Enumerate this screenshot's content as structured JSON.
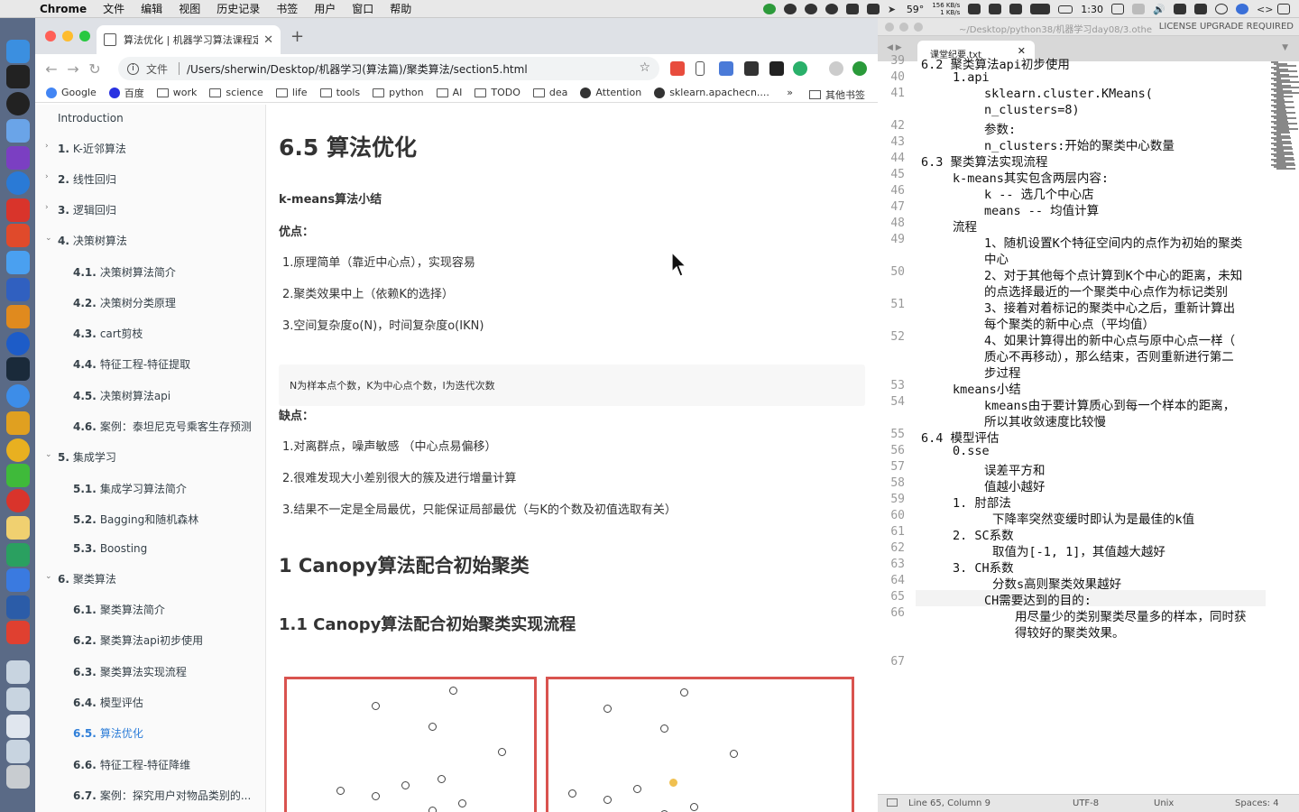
{
  "menubar": {
    "app": "Chrome",
    "menus": [
      "文件",
      "编辑",
      "视图",
      "历史记录",
      "书签",
      "用户",
      "窗口",
      "帮助"
    ],
    "temp": "59°",
    "net_up": "156 KB/s",
    "net_down": "1 KB/s",
    "battery": "1:30"
  },
  "browser": {
    "tab_title": "算法优化 | 机器学习算法课程定",
    "address_scheme": "文件",
    "address_url": "/Users/sherwin/Desktop/机器学习(算法篇)/聚类算法/section5.html",
    "bookmarks": [
      "Google",
      "百度",
      "work",
      "science",
      "life",
      "tools",
      "python",
      "AI",
      "TODO",
      "dea",
      "Attention",
      "sklearn.apachecn...."
    ],
    "bookmarks_more": "»",
    "bookmarks_other": "其他书签"
  },
  "sidebar": {
    "items": [
      {
        "num": "",
        "label": "Introduction",
        "level": 0,
        "arrow": ""
      },
      {
        "num": "1.",
        "label": "K-近邻算法",
        "level": 0,
        "arrow": "›"
      },
      {
        "num": "2.",
        "label": "线性回归",
        "level": 0,
        "arrow": "›"
      },
      {
        "num": "3.",
        "label": "逻辑回归",
        "level": 0,
        "arrow": "›"
      },
      {
        "num": "4.",
        "label": "决策树算法",
        "level": 0,
        "arrow": "⌄"
      },
      {
        "num": "4.1.",
        "label": "决策树算法简介",
        "level": 1,
        "arrow": ""
      },
      {
        "num": "4.2.",
        "label": "决策树分类原理",
        "level": 1,
        "arrow": ""
      },
      {
        "num": "4.3.",
        "label": "cart剪枝",
        "level": 1,
        "arrow": ""
      },
      {
        "num": "4.4.",
        "label": "特征工程-特征提取",
        "level": 1,
        "arrow": ""
      },
      {
        "num": "4.5.",
        "label": "决策树算法api",
        "level": 1,
        "arrow": ""
      },
      {
        "num": "4.6.",
        "label": "案例：泰坦尼克号乘客生存预测",
        "level": 1,
        "arrow": ""
      },
      {
        "num": "5.",
        "label": "集成学习",
        "level": 0,
        "arrow": "⌄"
      },
      {
        "num": "5.1.",
        "label": "集成学习算法简介",
        "level": 1,
        "arrow": ""
      },
      {
        "num": "5.2.",
        "label": "Bagging和随机森林",
        "level": 1,
        "arrow": ""
      },
      {
        "num": "5.3.",
        "label": "Boosting",
        "level": 1,
        "arrow": ""
      },
      {
        "num": "6.",
        "label": "聚类算法",
        "level": 0,
        "arrow": "⌄"
      },
      {
        "num": "6.1.",
        "label": "聚类算法简介",
        "level": 1,
        "arrow": ""
      },
      {
        "num": "6.2.",
        "label": "聚类算法api初步使用",
        "level": 1,
        "arrow": ""
      },
      {
        "num": "6.3.",
        "label": "聚类算法实现流程",
        "level": 1,
        "arrow": ""
      },
      {
        "num": "6.4.",
        "label": "模型评估",
        "level": 1,
        "arrow": ""
      },
      {
        "num": "6.5.",
        "label": "算法优化",
        "level": 1,
        "arrow": "",
        "active": true
      },
      {
        "num": "6.6.",
        "label": "特征工程-特征降维",
        "level": 1,
        "arrow": ""
      },
      {
        "num": "6.7.",
        "label": "案例：探究用户对物品类别的...",
        "level": 1,
        "arrow": ""
      }
    ]
  },
  "content": {
    "title": "6.5 算法优化",
    "summary_heading": "k-means算法小结",
    "pros_label": "优点：",
    "pros": [
      "1.原理简单（靠近中心点），实现容易",
      "2.聚类效果中上（依赖K的选择）",
      "3.空间复杂度o(N)，时间复杂度o(IKN)"
    ],
    "note": "N为样本点个数，K为中心点个数，I为迭代次数",
    "cons_label": "缺点：",
    "cons": [
      "1.对离群点，噪声敏感 （中心点易偏移）",
      "2.很难发现大小差别很大的簇及进行增量计算",
      "3.结果不一定是全局最优，只能保证局部最优（与K的个数及初值选取有关）"
    ],
    "section_h2": "1 Canopy算法配合初始聚类",
    "section_h3": "1.1 Canopy算法配合初始聚类实现流程"
  },
  "editor": {
    "path": "~/Desktop/python38/机器学习day08/3.othe",
    "license": "LICENSE UPGRADE REQUIRED",
    "tab": "课堂纪要.txt",
    "lines": [
      {
        "n": "39",
        "indent": 0,
        "text": "6.2 聚类算法api初步使用"
      },
      {
        "n": "40",
        "indent": 1,
        "text": "1.api"
      },
      {
        "n": "41",
        "indent": 2,
        "text": "sklearn.cluster.KMeans("
      },
      {
        "n": "",
        "indent": 2,
        "text": "n_clusters=8)"
      },
      {
        "n": "42",
        "indent": 2,
        "text": "参数:"
      },
      {
        "n": "43",
        "indent": 2,
        "text": "n_clusters:开始的聚类中心数量"
      },
      {
        "n": "44",
        "indent": 0,
        "text": "6.3 聚类算法实现流程"
      },
      {
        "n": "45",
        "indent": 1,
        "text": "k-means其实包含两层内容:"
      },
      {
        "n": "46",
        "indent": 2,
        "text": "k -- 选几个中心店"
      },
      {
        "n": "47",
        "indent": 2,
        "text": "means -- 均值计算"
      },
      {
        "n": "48",
        "indent": 1,
        "text": "流程"
      },
      {
        "n": "49",
        "indent": 2,
        "text": "1、随机设置K个特征空间内的点作为初始的聚类"
      },
      {
        "n": "",
        "indent": 2,
        "text": "中心"
      },
      {
        "n": "50",
        "indent": 2,
        "text": "2、对于其他每个点计算到K个中心的距离，未知"
      },
      {
        "n": "",
        "indent": 2,
        "text": "的点选择最近的一个聚类中心点作为标记类别"
      },
      {
        "n": "51",
        "indent": 2,
        "text": "3、接着对着标记的聚类中心之后，重新计算出"
      },
      {
        "n": "",
        "indent": 2,
        "text": "每个聚类的新中心点（平均值）"
      },
      {
        "n": "52",
        "indent": 2,
        "text": "4、如果计算得出的新中心点与原中心点一样（"
      },
      {
        "n": "",
        "indent": 2,
        "text": "质心不再移动），那么结束，否则重新进行第二"
      },
      {
        "n": "",
        "indent": 2,
        "text": "步过程"
      },
      {
        "n": "53",
        "indent": 1,
        "text": "kmeans小结"
      },
      {
        "n": "54",
        "indent": 2,
        "text": "kmeans由于要计算质心到每一个样本的距离，"
      },
      {
        "n": "",
        "indent": 2,
        "text": "所以其收敛速度比较慢"
      },
      {
        "n": "55",
        "indent": 0,
        "text": "6.4 模型评估"
      },
      {
        "n": "56",
        "indent": 1,
        "text": "0.sse"
      },
      {
        "n": "57",
        "indent": 2,
        "text": "误差平方和"
      },
      {
        "n": "58",
        "indent": 2,
        "text": "值越小越好"
      },
      {
        "n": "59",
        "indent": 1,
        "text": "1. 肘部法"
      },
      {
        "n": "60",
        "indent": 3,
        "text": "下降率突然变缓时即认为是最佳的k值"
      },
      {
        "n": "61",
        "indent": 1,
        "text": "2. SC系数"
      },
      {
        "n": "62",
        "indent": 3,
        "text": "取值为[-1, 1]，其值越大越好"
      },
      {
        "n": "63",
        "indent": 1,
        "text": "3. CH系数"
      },
      {
        "n": "64",
        "indent": 3,
        "text": "分数s高则聚类效果越好"
      },
      {
        "n": "65",
        "indent": 2,
        "text": "CH需要达到的目的:"
      },
      {
        "n": "66",
        "indent": 4,
        "text": "用尽量少的类别聚类尽量多的样本，同时获"
      },
      {
        "n": "",
        "indent": 4,
        "text": "得较好的聚类效果。"
      },
      {
        "n": "",
        "indent": 0,
        "text": ""
      },
      {
        "n": "67",
        "indent": 0,
        "text": ""
      }
    ],
    "status_pos": "Line 65, Column 9",
    "status_enc": "UTF-8",
    "status_eol": "Unix",
    "status_spaces": "Spaces: 4"
  }
}
